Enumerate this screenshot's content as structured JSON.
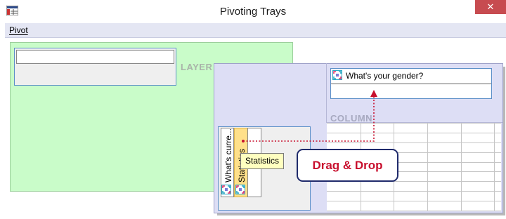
{
  "window": {
    "title": "Pivoting Trays",
    "close_glyph": "✕"
  },
  "menu": {
    "items": [
      "Pivot"
    ]
  },
  "trays": {
    "layer_label": "LAYER",
    "column_label": "COLUMN",
    "column_variable": "What's your gender?",
    "row_variable_1": "What's curre...",
    "row_variable_2": "Statistics"
  },
  "tooltip": {
    "text": "Statistics"
  },
  "callout": {
    "text": "Drag & Drop"
  },
  "colors": {
    "layer_tray": "#c9fcc9",
    "pivot_panel": "#dddef5",
    "accent_blue": "#5b8fc8",
    "callout_text": "#c8102e",
    "callout_border": "#1f2a6b",
    "drag_arrow": "#c8102e",
    "close_button": "#c74b50"
  },
  "icons": {
    "app": "pivot-table-app-icon",
    "variable": "variable-pill-icon"
  }
}
